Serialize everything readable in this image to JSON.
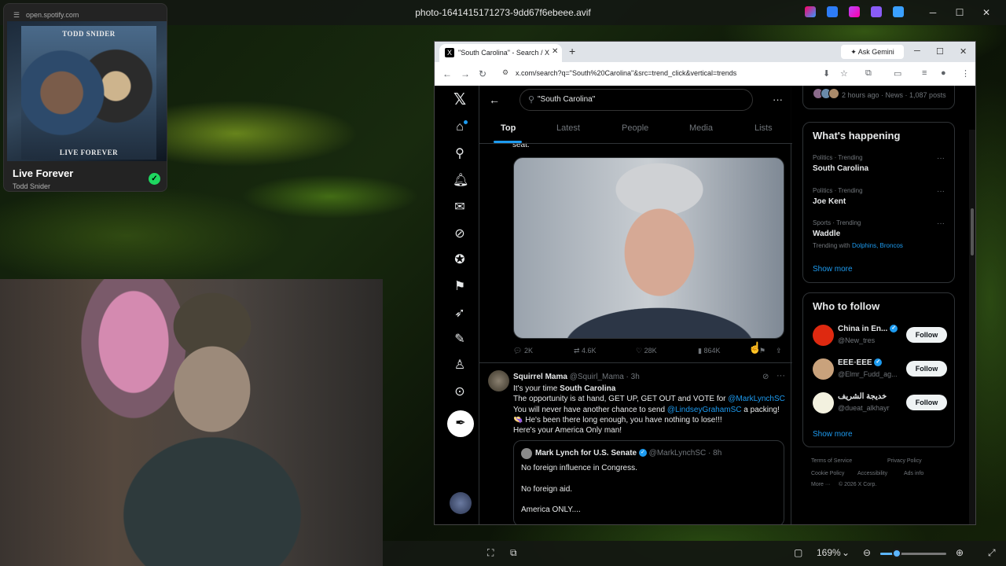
{
  "viewer": {
    "title": "photo-1641415171273-9dd67f6ebeee.avif",
    "zoom": "169%",
    "zoom_fraction": 0.25,
    "controls": [
      "─",
      "☐",
      "✕"
    ]
  },
  "spotify": {
    "url": "open.spotify.com",
    "album_top_text": "TODD SNIDER",
    "album_bottom_text": "LIVE FOREVER",
    "track": "Live Forever",
    "artist": "Todd Snider"
  },
  "browser": {
    "tab_title": "\"South Carolina\" - Search / X",
    "ask_gemini": "Ask Gemini",
    "url": "x.com/search?q=\"South%20Carolina\"&src=trend_click&vertical=trends"
  },
  "x": {
    "search_query": "\"South Carolina\"",
    "tabs": [
      "Top",
      "Latest",
      "People",
      "Media",
      "Lists"
    ],
    "tweet1": {
      "text_tail": "seat.",
      "replies": "2K",
      "reposts": "4.6K",
      "likes": "28K",
      "views": "864K"
    },
    "tweet2": {
      "name": "Squirrel Mama",
      "handle": "@Squirl_Mama",
      "time": "· 3h",
      "line1_pre": "It's your time ",
      "line1_bold": "South Carolina",
      "line2_pre": "The opportunity is at hand, GET UP, GET OUT and VOTE for ",
      "line2_link": "@MarkLynchSC",
      "line3_pre": "You will never have another chance to send ",
      "line3_link": "@LindseyGrahamSC",
      "line3_post": " a packing!",
      "line4": "👒 He's been there long enough, you have nothing to lose!!!",
      "line5": "Here's your America Only  man!",
      "quote": {
        "name": "Mark Lynch for U.S. Senate",
        "handle": "@MarkLynchSC",
        "time": "· 8h",
        "line1": "No foreign influence in Congress.",
        "line2": "No foreign aid.",
        "line3": "America ONLY...."
      }
    },
    "sidebar": {
      "news_meta": "2 hours ago · News · 1,087 posts",
      "happening_title": "What's happening",
      "trends": [
        {
          "category": "Politics · Trending",
          "name": "South Carolina"
        },
        {
          "category": "Politics · Trending",
          "name": "Joe Kent"
        },
        {
          "category": "Sports · Trending",
          "name": "Waddle",
          "with_label": "Trending with",
          "with_links": "Dolphins, Broncos"
        }
      ],
      "show_more": "Show more",
      "who_title": "Who to follow",
      "follow": [
        {
          "name": "China in En...",
          "handle": "@New_tres",
          "button": "Follow"
        },
        {
          "name": "EEE◦EEE",
          "handle": "@Elmr_Fudd_ag...",
          "button": "Follow"
        },
        {
          "name": "خديجة الشريف",
          "handle": "@dueat_alkhayr",
          "button": "Follow"
        }
      ],
      "footer": [
        "Terms of Service",
        "Privacy Policy",
        "Cookie Policy",
        "Accessibility",
        "Ads info",
        "More ···",
        "© 2026 X Corp."
      ]
    }
  }
}
